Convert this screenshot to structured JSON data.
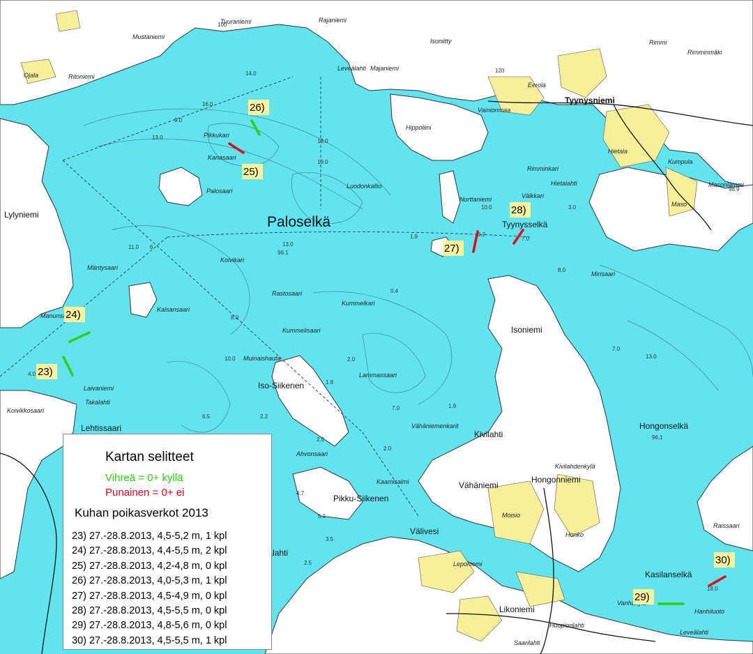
{
  "map": {
    "colors": {
      "water": "#62e3f0",
      "land": "#ffffff",
      "fields": "#f8ef9b",
      "contour": "#444444",
      "marker_bg": "#fff3a0",
      "yes_line": "#2ad10f",
      "no_line": "#e5001b"
    },
    "place_names": {
      "paloselka": "Paloselkä",
      "tyynysniemi": "Tyynysniemi",
      "tyynysselka": "Tyynysselkä",
      "hongonselka": "Hongonselkä",
      "hongonniemi": "Hongonniemi",
      "isoniemi": "Isoniemi",
      "kivilahti": "Kivilahti",
      "valivesi": "Välivesi",
      "kasilanselka": "Kasilanselkä",
      "lylyniemi": "Lylyniemi",
      "musta_niemi": "Mustaniemi",
      "tuuraniemi": "Tuuraniemi",
      "levealahti": "Leveälahti",
      "vainionmaa": "Vainionmaa",
      "hippoliini": "Hippoliini",
      "kumpula": "Kumpula",
      "hietala": "Hietala",
      "hietalahti": "Hietalahti",
      "rimminkari": "Rimminkari",
      "rimmi": "Rimmi",
      "rimminmaki": "Rimminmäki",
      "masonlammi": "Masonlammi",
      "maso": "Maso",
      "noretaniemi": "Norttaniemi",
      "valkkari": "Välkkari",
      "luodonkallio": "Luodonkallio",
      "palosaari": "Palosaari",
      "kanasaari": "Kanasaari",
      "pikkukari": "Pikkukari",
      "mantysaari": "Mäntysaari",
      "kolvikari": "Koivikari",
      "kaisansaari": "Kaisansaari",
      "rastosaari": "Rastosaari",
      "kummelkari": "Kummelkari",
      "kummelisaari": "Kummelisaari",
      "muinaishauta": "Muinaishauta",
      "iso_siikenen": "Iso-Siikenen",
      "pikku_siikenen": "Pikku-Siikenen",
      "lammassaari": "Lammassaari",
      "vahaniemenkarit": "Vähäniemenkarit",
      "vahaniemi": "Vähäniemi",
      "ahvonsaari": "Ahvonsaari",
      "kaamisalmi": "Kaamisalmi",
      "manunsaari": "Manunsaari",
      "laivaniemi": "Laivaniemi",
      "takalahti": "Takalahti",
      "koivikkosaari": "Koivikkosaari",
      "lohtissaari": "Lehtissaari",
      "leponiemi": "Leponiemi",
      "likoniemi": "Likoniemi",
      "huopionlahti": "Huopionlahti",
      "vanhakyla": "Vanhakylä",
      "hanhiluoto": "Hanhiluoto",
      "levealahti2": "Leveälahti",
      "rajaniemi": "Rajaniemi",
      "majaniemi": "Majaniemi",
      "isoniitty": "Isoniitty",
      "eerola": "Eerola",
      "kivilahdenkyla": "Kivilahdenkylä",
      "moisio": "Moisio",
      "honko": "Honko",
      "saarilahti": "Saarilahti",
      "lokalahti": "Lokalahti",
      "mirisaari": "Mirisaari",
      "raissaari": "Raissaari",
      "ojala": "Ojala",
      "ritoniemi": "Ritoniemi"
    },
    "depth_labels": [
      "14.0",
      "16.0",
      "9.0",
      "13.0",
      "19.0",
      "18.0",
      "13.0",
      "96.1",
      "10.0",
      "6.2",
      "7.0",
      "3.0",
      "8.0",
      "11.0",
      "6",
      "8.0",
      "10.0",
      "2.2",
      "1.8",
      "2.0",
      "7.0",
      "1.9",
      "0.4",
      "2.0",
      "6.5",
      "4.7",
      "5.1",
      "3.5",
      "2.5",
      "96.1",
      "7.0",
      "13.0",
      "18.0",
      "1.9",
      "98.9",
      "4.0",
      "2.0",
      "120",
      "100"
    ],
    "markers": [
      {
        "id": "23",
        "label": "23)",
        "result": "yes"
      },
      {
        "id": "24",
        "label": "24)",
        "result": "yes"
      },
      {
        "id": "25",
        "label": "25)",
        "result": "no"
      },
      {
        "id": "26",
        "label": "26)",
        "result": "yes"
      },
      {
        "id": "27",
        "label": "27)",
        "result": "no"
      },
      {
        "id": "28",
        "label": "28)",
        "result": "no"
      },
      {
        "id": "29",
        "label": "29)",
        "result": "yes"
      },
      {
        "id": "30",
        "label": "30)",
        "result": "no"
      }
    ]
  },
  "legend": {
    "title": "Kartan selitteet",
    "green_text": "Vihreä = 0+ kyllä",
    "red_text": "Punainen = 0+ ei",
    "subtitle": "Kuhan poikasverkot 2013",
    "items": [
      "23) 27.-28.8.2013, 4,5-5,2 m, 1 kpl",
      "24) 27.-28.8.2013, 4,4-5,5 m, 2 kpl",
      "25) 27.-28.8.2013, 4,2-4,8 m, 0 kpl",
      "26) 27.-28.8.2013, 4,0-5,3 m, 1 kpl",
      "27) 27.-28.8.2013, 4,5-4,9 m, 0 kpl",
      "28) 27.-28.8.2013, 4,5-5,5 m, 0 kpl",
      "29) 27.-28.8.2013, 4,8-5,6 m, 0 kpl",
      "30) 27.-28.8.2013, 4,5-5,5 m, 1 kpl"
    ]
  }
}
